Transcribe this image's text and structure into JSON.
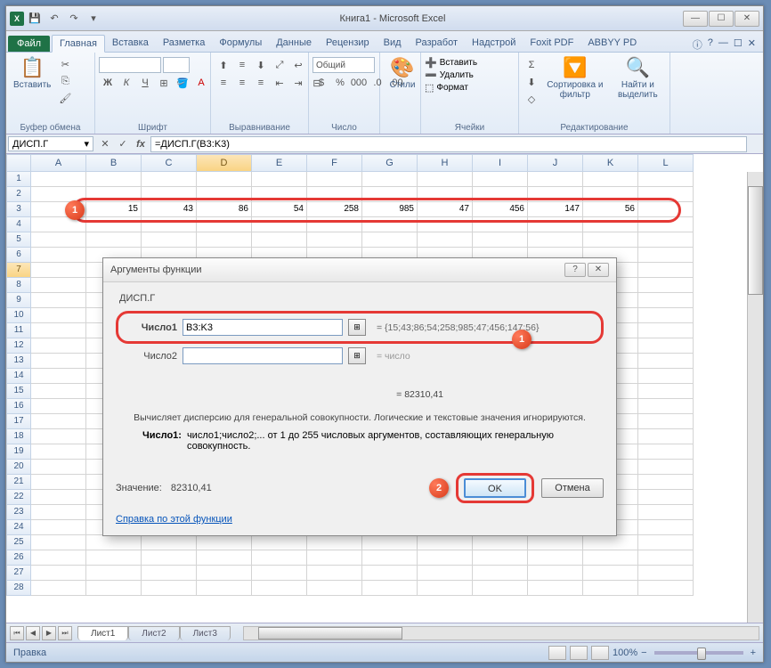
{
  "title": "Книга1 - Microsoft Excel",
  "ribbon": {
    "file": "Файл",
    "tabs": [
      "Главная",
      "Вставка",
      "Разметка",
      "Формулы",
      "Данные",
      "Рецензир",
      "Вид",
      "Разработ",
      "Надстрой",
      "Foxit PDF",
      "ABBYY PD"
    ],
    "active": 0,
    "groups": {
      "clipboard": {
        "paste": "Вставить",
        "label": "Буфер обмена"
      },
      "font": {
        "label": "Шрифт"
      },
      "align": {
        "label": "Выравнивание"
      },
      "number": {
        "format": "Общий",
        "label": "Число"
      },
      "styles": {
        "btn": "Стили"
      },
      "cells": {
        "insert": "Вставить",
        "delete": "Удалить",
        "format": "Формат",
        "label": "Ячейки"
      },
      "editing": {
        "sort": "Сортировка и фильтр",
        "find": "Найти и выделить",
        "label": "Редактирование"
      }
    }
  },
  "namebox": "ДИСП.Г",
  "formula": "=ДИСП.Г(B3:K3)",
  "columns": [
    "A",
    "B",
    "C",
    "D",
    "E",
    "F",
    "G",
    "H",
    "I",
    "J",
    "K",
    "L"
  ],
  "rows_count": 28,
  "selected_col": "D",
  "selected_row": 7,
  "data_row": {
    "row": 3,
    "values": [
      "",
      "15",
      "43",
      "86",
      "54",
      "258",
      "985",
      "47",
      "456",
      "147",
      "56",
      ""
    ]
  },
  "dialog": {
    "title": "Аргументы функции",
    "func": "ДИСП.Г",
    "arg1_label": "Число1",
    "arg1_value": "B3:K3",
    "arg1_result": "= {15;43;86;54;258;985;47;456;147;56}",
    "arg2_label": "Число2",
    "arg2_result": "= число",
    "calc_result": "= 82310,41",
    "desc": "Вычисляет дисперсию для генеральной совокупности. Логические и текстовые значения игнорируются.",
    "detail_label": "Число1:",
    "detail_text": "число1;число2;... от 1 до 255 числовых аргументов, составляющих генеральную совокупность.",
    "value_label": "Значение:",
    "value": "82310,41",
    "help": "Справка по этой функции",
    "ok": "OK",
    "cancel": "Отмена"
  },
  "sheets": [
    "Лист1",
    "Лист2",
    "Лист3"
  ],
  "status": "Правка",
  "zoom": "100%",
  "callouts": {
    "c1": "1",
    "c2": "1",
    "c3": "2"
  }
}
